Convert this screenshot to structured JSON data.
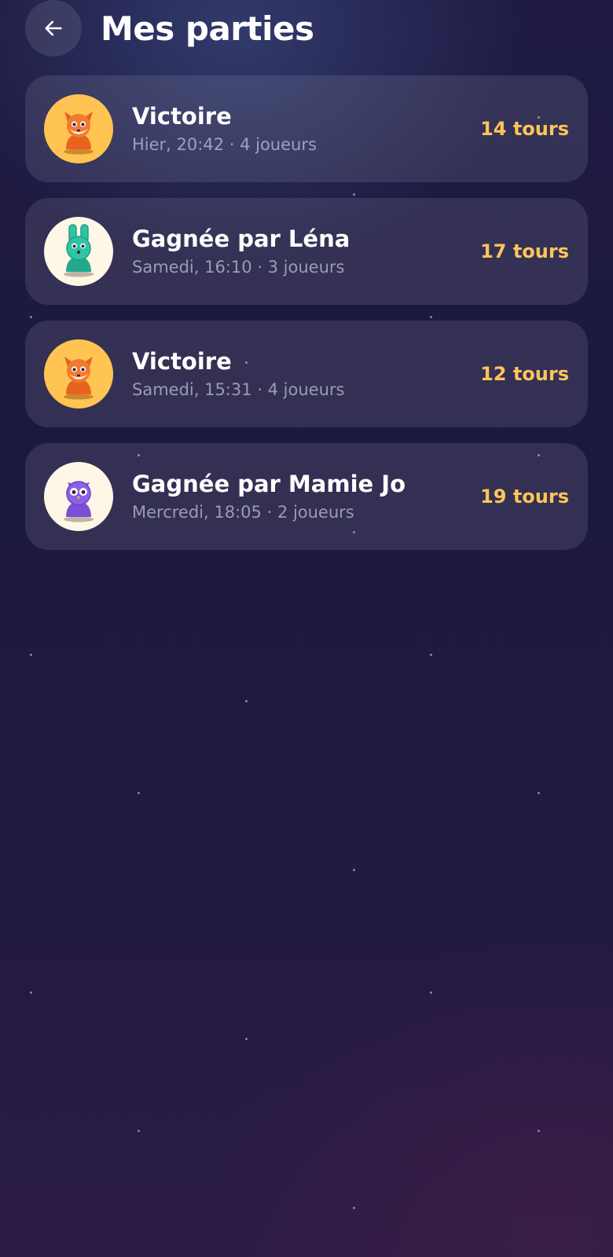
{
  "header": {
    "back_icon": "arrow-left-icon",
    "title": "Mes parties"
  },
  "colors": {
    "accent": "#ffc45a",
    "fox_avatar_bg": "#ffc451",
    "light_avatar_bg": "#fff7e6"
  },
  "games": [
    {
      "avatar": "fox-icon",
      "title": "Victoire",
      "meta": "Hier, 20:42 · 4 joueurs",
      "turns": "14 tours"
    },
    {
      "avatar": "bunny-icon",
      "title": "Gagnée par Léna",
      "meta": "Samedi, 16:10 · 3 joueurs",
      "turns": "17 tours"
    },
    {
      "avatar": "fox-icon",
      "title": "Victoire",
      "meta": "Samedi, 15:31 · 4 joueurs",
      "turns": "12 tours"
    },
    {
      "avatar": "owl-icon",
      "title": "Gagnée par Mamie Jo",
      "meta": "Mercredi, 18:05 · 2 joueurs",
      "turns": "19 tours"
    }
  ]
}
